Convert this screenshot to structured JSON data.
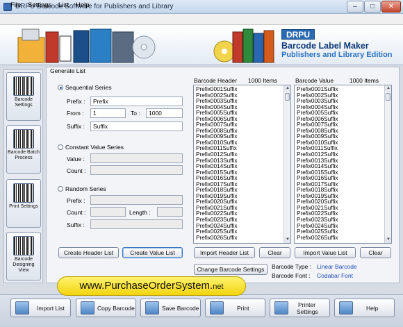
{
  "window": {
    "title": "DRPU Barcode Software for Publishers and Library"
  },
  "menu": [
    "File",
    "Settings",
    "List",
    "Help"
  ],
  "banner": {
    "logo": "DRPU",
    "title": "Barcode Label Maker",
    "subtitle": "Publishers and Library Edition"
  },
  "sidebar": {
    "items": [
      {
        "label": "Barcode Settings"
      },
      {
        "label": "Barcode Batch Process"
      },
      {
        "label": "Print Settings"
      },
      {
        "label": "Barcode Designing View"
      }
    ]
  },
  "generate": {
    "title": "Generate List",
    "sequential": {
      "label": "Sequential Series",
      "selected": true,
      "prefix_label": "Prefix :",
      "prefix_value": "Prefix",
      "from_label": "From :",
      "from_value": "1",
      "to_label": "To :",
      "to_value": "1000",
      "suffix_label": "Suffix :",
      "suffix_value": "Suffix"
    },
    "constant": {
      "label": "Constant Value Series",
      "value_label": "Value :",
      "count_label": "Count :"
    },
    "random": {
      "label": "Random Series",
      "prefix_label": "Prefix :",
      "count_label": "Count :",
      "length_label": "Length :",
      "suffix_label": "Suffix :"
    },
    "create_header_label": "Create Header List",
    "create_value_label": "Create Value List"
  },
  "header_list": {
    "title": "Barcode Header",
    "count": "1000 Items",
    "items": [
      "Prefix0001Suffix",
      "Prefix0002Suffix",
      "Prefix0003Suffix",
      "Prefix0004Suffix",
      "Prefix0005Suffix",
      "Prefix0006Suffix",
      "Prefix0007Suffix",
      "Prefix0008Suffix",
      "Prefix0009Suffix",
      "Prefix0010Suffix",
      "Prefix0011Suffix",
      "Prefix0012Suffix",
      "Prefix0013Suffix",
      "Prefix0014Suffix",
      "Prefix0015Suffix",
      "Prefix0016Suffix",
      "Prefix0017Suffix",
      "Prefix0018Suffix",
      "Prefix0019Suffix",
      "Prefix0020Suffix",
      "Prefix0021Suffix",
      "Prefix0022Suffix",
      "Prefix0023Suffix",
      "Prefix0024Suffix",
      "Prefix0025Suffix",
      "Prefix0026Suffix"
    ],
    "import_label": "Import Header List",
    "clear_label": "Clear"
  },
  "value_list": {
    "title": "Barcode Value",
    "count": "1000 Items",
    "items": [
      "Prefix0001Suffix",
      "Prefix0002Suffix",
      "Prefix0003Suffix",
      "Prefix0004Suffix",
      "Prefix0005Suffix",
      "Prefix0006Suffix",
      "Prefix0007Suffix",
      "Prefix0008Suffix",
      "Prefix0009Suffix",
      "Prefix0010Suffix",
      "Prefix0011Suffix",
      "Prefix0012Suffix",
      "Prefix0013Suffix",
      "Prefix0014Suffix",
      "Prefix0015Suffix",
      "Prefix0016Suffix",
      "Prefix0017Suffix",
      "Prefix0018Suffix",
      "Prefix0019Suffix",
      "Prefix0020Suffix",
      "Prefix0021Suffix",
      "Prefix0022Suffix",
      "Prefix0023Suffix",
      "Prefix0024Suffix",
      "Prefix0025Suffix",
      "Prefix0026Suffix"
    ],
    "import_label": "Import Value List",
    "clear_label": "Clear"
  },
  "change_settings_label": "Change Barcode Settings",
  "barcode_info": {
    "type_label": "Barcode Type :",
    "type_value": "Linear Barcode",
    "font_label": "Barcode Font :",
    "font_value": "Codabar Font"
  },
  "promo": {
    "main": "www.PurchaseOrderSystem.",
    "tld": "net"
  },
  "toolbar": {
    "import_list": "Import List",
    "copy_barcode": "Copy Barcode",
    "save_barcode": "Save Barcode",
    "print": "Print",
    "printer_settings_line1": "Printer",
    "printer_settings_line2": "Settings",
    "help": "Help"
  },
  "colors": {
    "accent": "#2a6ab2",
    "info_value": "#1b47b8",
    "promo": "#f3d40e"
  }
}
